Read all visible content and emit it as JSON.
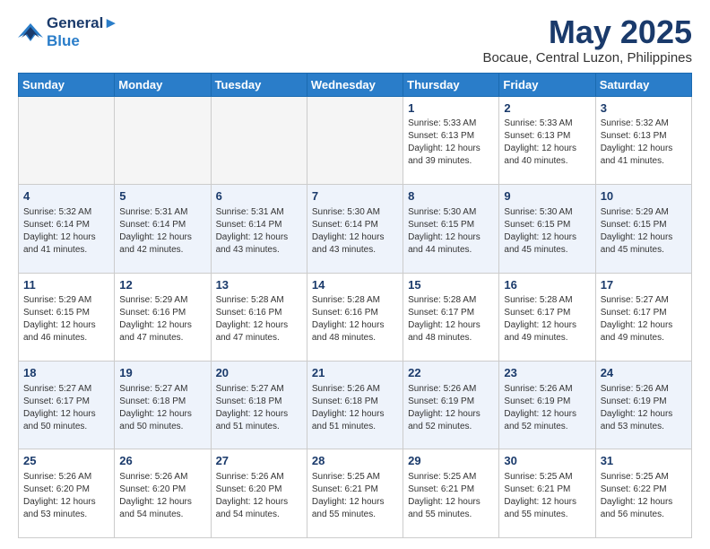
{
  "logo": {
    "line1": "General",
    "line2": "Blue"
  },
  "title": "May 2025",
  "subtitle": "Bocaue, Central Luzon, Philippines",
  "weekdays": [
    "Sunday",
    "Monday",
    "Tuesday",
    "Wednesday",
    "Thursday",
    "Friday",
    "Saturday"
  ],
  "weeks": [
    [
      {
        "day": "",
        "info": ""
      },
      {
        "day": "",
        "info": ""
      },
      {
        "day": "",
        "info": ""
      },
      {
        "day": "",
        "info": ""
      },
      {
        "day": "1",
        "info": "Sunrise: 5:33 AM\nSunset: 6:13 PM\nDaylight: 12 hours\nand 39 minutes."
      },
      {
        "day": "2",
        "info": "Sunrise: 5:33 AM\nSunset: 6:13 PM\nDaylight: 12 hours\nand 40 minutes."
      },
      {
        "day": "3",
        "info": "Sunrise: 5:32 AM\nSunset: 6:13 PM\nDaylight: 12 hours\nand 41 minutes."
      }
    ],
    [
      {
        "day": "4",
        "info": "Sunrise: 5:32 AM\nSunset: 6:14 PM\nDaylight: 12 hours\nand 41 minutes."
      },
      {
        "day": "5",
        "info": "Sunrise: 5:31 AM\nSunset: 6:14 PM\nDaylight: 12 hours\nand 42 minutes."
      },
      {
        "day": "6",
        "info": "Sunrise: 5:31 AM\nSunset: 6:14 PM\nDaylight: 12 hours\nand 43 minutes."
      },
      {
        "day": "7",
        "info": "Sunrise: 5:30 AM\nSunset: 6:14 PM\nDaylight: 12 hours\nand 43 minutes."
      },
      {
        "day": "8",
        "info": "Sunrise: 5:30 AM\nSunset: 6:15 PM\nDaylight: 12 hours\nand 44 minutes."
      },
      {
        "day": "9",
        "info": "Sunrise: 5:30 AM\nSunset: 6:15 PM\nDaylight: 12 hours\nand 45 minutes."
      },
      {
        "day": "10",
        "info": "Sunrise: 5:29 AM\nSunset: 6:15 PM\nDaylight: 12 hours\nand 45 minutes."
      }
    ],
    [
      {
        "day": "11",
        "info": "Sunrise: 5:29 AM\nSunset: 6:15 PM\nDaylight: 12 hours\nand 46 minutes."
      },
      {
        "day": "12",
        "info": "Sunrise: 5:29 AM\nSunset: 6:16 PM\nDaylight: 12 hours\nand 47 minutes."
      },
      {
        "day": "13",
        "info": "Sunrise: 5:28 AM\nSunset: 6:16 PM\nDaylight: 12 hours\nand 47 minutes."
      },
      {
        "day": "14",
        "info": "Sunrise: 5:28 AM\nSunset: 6:16 PM\nDaylight: 12 hours\nand 48 minutes."
      },
      {
        "day": "15",
        "info": "Sunrise: 5:28 AM\nSunset: 6:17 PM\nDaylight: 12 hours\nand 48 minutes."
      },
      {
        "day": "16",
        "info": "Sunrise: 5:28 AM\nSunset: 6:17 PM\nDaylight: 12 hours\nand 49 minutes."
      },
      {
        "day": "17",
        "info": "Sunrise: 5:27 AM\nSunset: 6:17 PM\nDaylight: 12 hours\nand 49 minutes."
      }
    ],
    [
      {
        "day": "18",
        "info": "Sunrise: 5:27 AM\nSunset: 6:17 PM\nDaylight: 12 hours\nand 50 minutes."
      },
      {
        "day": "19",
        "info": "Sunrise: 5:27 AM\nSunset: 6:18 PM\nDaylight: 12 hours\nand 50 minutes."
      },
      {
        "day": "20",
        "info": "Sunrise: 5:27 AM\nSunset: 6:18 PM\nDaylight: 12 hours\nand 51 minutes."
      },
      {
        "day": "21",
        "info": "Sunrise: 5:26 AM\nSunset: 6:18 PM\nDaylight: 12 hours\nand 51 minutes."
      },
      {
        "day": "22",
        "info": "Sunrise: 5:26 AM\nSunset: 6:19 PM\nDaylight: 12 hours\nand 52 minutes."
      },
      {
        "day": "23",
        "info": "Sunrise: 5:26 AM\nSunset: 6:19 PM\nDaylight: 12 hours\nand 52 minutes."
      },
      {
        "day": "24",
        "info": "Sunrise: 5:26 AM\nSunset: 6:19 PM\nDaylight: 12 hours\nand 53 minutes."
      }
    ],
    [
      {
        "day": "25",
        "info": "Sunrise: 5:26 AM\nSunset: 6:20 PM\nDaylight: 12 hours\nand 53 minutes."
      },
      {
        "day": "26",
        "info": "Sunrise: 5:26 AM\nSunset: 6:20 PM\nDaylight: 12 hours\nand 54 minutes."
      },
      {
        "day": "27",
        "info": "Sunrise: 5:26 AM\nSunset: 6:20 PM\nDaylight: 12 hours\nand 54 minutes."
      },
      {
        "day": "28",
        "info": "Sunrise: 5:25 AM\nSunset: 6:21 PM\nDaylight: 12 hours\nand 55 minutes."
      },
      {
        "day": "29",
        "info": "Sunrise: 5:25 AM\nSunset: 6:21 PM\nDaylight: 12 hours\nand 55 minutes."
      },
      {
        "day": "30",
        "info": "Sunrise: 5:25 AM\nSunset: 6:21 PM\nDaylight: 12 hours\nand 55 minutes."
      },
      {
        "day": "31",
        "info": "Sunrise: 5:25 AM\nSunset: 6:22 PM\nDaylight: 12 hours\nand 56 minutes."
      }
    ]
  ]
}
